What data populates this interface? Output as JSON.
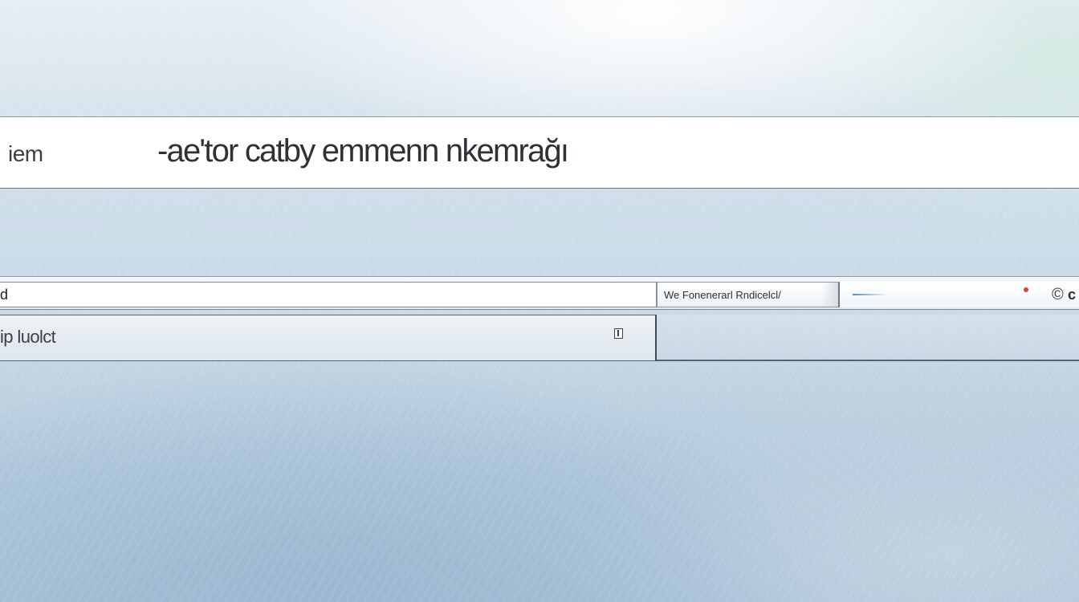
{
  "header": {
    "left_label": "iem",
    "title": "-ae'tor catby emmenn nkemrağı"
  },
  "toolbar": {
    "address_prefix": "d",
    "address_value": "",
    "search_text": "We Fonenerarl Rndicelcl/",
    "icons": [
      "progress-line",
      "status-dot",
      "copyright-icon"
    ],
    "right_letter": "c"
  },
  "sub_panel": {
    "label": "ip luolct"
  },
  "colors": {
    "status_dot": "#e0413b",
    "background_top": "#e6eef4",
    "background_bottom": "#a9c2d8"
  }
}
